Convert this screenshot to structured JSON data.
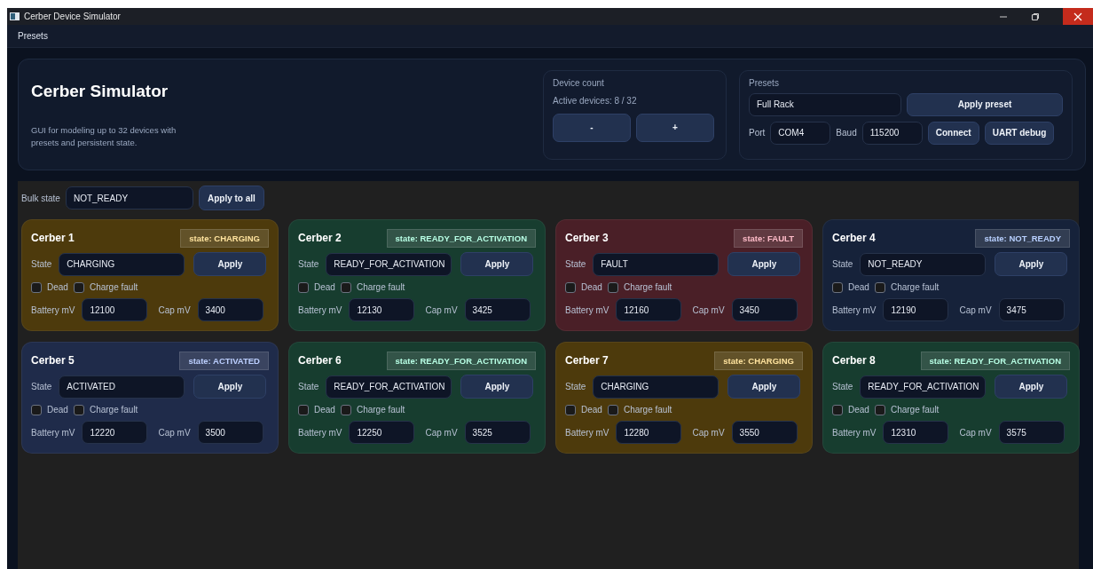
{
  "window": {
    "title": "Cerber Device Simulator"
  },
  "menu": [
    "Presets"
  ],
  "header": {
    "title": "Cerber Simulator",
    "description": "GUI for modeling up to 32 devices with\npresets and persistent state.",
    "device_count": {
      "label": "Device count",
      "active": "Active devices: 8 / 32",
      "buttons": [
        "-",
        "+"
      ]
    },
    "presets": {
      "label": "Presets",
      "preset_value": "Full Rack",
      "apply_button": "Apply preset",
      "port_label": "Port",
      "port_value": "COM4",
      "baud_label": "Baud",
      "baud_value": "115200",
      "buttons": [
        "Connect",
        "UART debug"
      ]
    }
  },
  "bulk": {
    "label": "Bulk state",
    "value": "NOT_READY",
    "button": "Apply to all"
  },
  "devices": [
    {
      "name": "Cerber 1",
      "badge": "state: CHARGING",
      "color": "#4d3a0c",
      "state_label": "State",
      "state_value": "CHARGING",
      "apply": "Apply",
      "dead": {
        "label": "Dead",
        "checked": false
      },
      "charge_fault": {
        "label": "Charge fault",
        "checked": false
      },
      "battery_label": "Battery mV",
      "battery_value": "12100",
      "cap_label": "Cap mV",
      "cap_value": "3400"
    },
    {
      "name": "Cerber 2",
      "badge": "state: READY_FOR_ACTIVATION",
      "color": "#173d2f",
      "state_label": "State",
      "state_value": "READY_FOR_ACTIVATION",
      "apply": "Apply",
      "dead": {
        "label": "Dead",
        "checked": false
      },
      "charge_fault": {
        "label": "Charge fault",
        "checked": false
      },
      "battery_label": "Battery mV",
      "battery_value": "12130",
      "cap_label": "Cap mV",
      "cap_value": "3425"
    },
    {
      "name": "Cerber 3",
      "badge": "state: FAULT",
      "color": "#4a1f27",
      "state_label": "State",
      "state_value": "FAULT",
      "apply": "Apply",
      "dead": {
        "label": "Dead",
        "checked": false
      },
      "charge_fault": {
        "label": "Charge fault",
        "checked": false
      },
      "battery_label": "Battery mV",
      "battery_value": "12160",
      "cap_label": "Cap mV",
      "cap_value": "3450"
    },
    {
      "name": "Cerber 4",
      "badge": "state: NOT_READY",
      "color": "#16223a",
      "state_label": "State",
      "state_value": "NOT_READY",
      "apply": "Apply",
      "dead": {
        "label": "Dead",
        "checked": false
      },
      "charge_fault": {
        "label": "Charge fault",
        "checked": false
      },
      "battery_label": "Battery mV",
      "battery_value": "12190",
      "cap_label": "Cap mV",
      "cap_value": "3475"
    },
    {
      "name": "Cerber 5",
      "badge": "state: ACTIVATED",
      "color": "#1f2b4a",
      "state_label": "State",
      "state_value": "ACTIVATED",
      "apply": "Apply",
      "dead": {
        "label": "Dead",
        "checked": false
      },
      "charge_fault": {
        "label": "Charge fault",
        "checked": false
      },
      "battery_label": "Battery mV",
      "battery_value": "12220",
      "cap_label": "Cap mV",
      "cap_value": "3500"
    },
    {
      "name": "Cerber 6",
      "badge": "state: READY_FOR_ACTIVATION",
      "color": "#173d2f",
      "state_label": "State",
      "state_value": "READY_FOR_ACTIVATION",
      "apply": "Apply",
      "dead": {
        "label": "Dead",
        "checked": false
      },
      "charge_fault": {
        "label": "Charge fault",
        "checked": false
      },
      "battery_label": "Battery mV",
      "battery_value": "12250",
      "cap_label": "Cap mV",
      "cap_value": "3525"
    },
    {
      "name": "Cerber 7",
      "badge": "state: CHARGING",
      "color": "#4d3a0c",
      "state_label": "State",
      "state_value": "CHARGING",
      "apply": "Apply",
      "dead": {
        "label": "Dead",
        "checked": false
      },
      "charge_fault": {
        "label": "Charge fault",
        "checked": false
      },
      "battery_label": "Battery mV",
      "battery_value": "12280",
      "cap_label": "Cap mV",
      "cap_value": "3550"
    },
    {
      "name": "Cerber 8",
      "badge": "state: READY_FOR_ACTIVATION",
      "color": "#173d2f",
      "state_label": "State",
      "state_value": "READY_FOR_ACTIVATION",
      "apply": "Apply",
      "dead": {
        "label": "Dead",
        "checked": false
      },
      "charge_fault": {
        "label": "Charge fault",
        "checked": false
      },
      "battery_label": "Battery mV",
      "battery_value": "12310",
      "cap_label": "Cap mV",
      "cap_value": "3575"
    }
  ]
}
